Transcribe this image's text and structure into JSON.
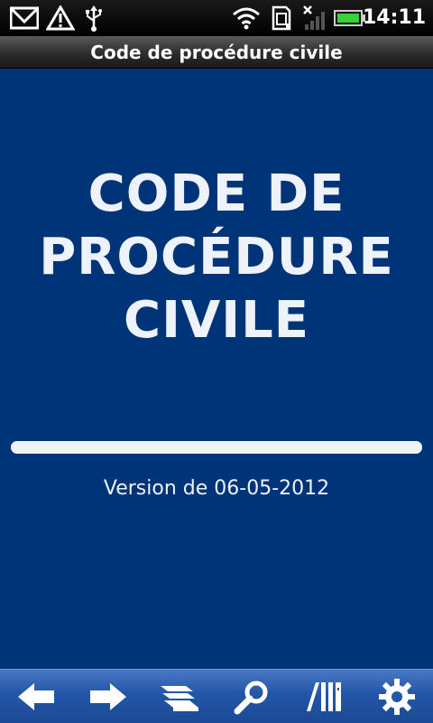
{
  "status_bar": {
    "time": "14:11",
    "icons": [
      "gmail-icon",
      "warning-icon",
      "usb-icon",
      "wifi-icon",
      "sd-card-icon",
      "signal-icon",
      "battery-icon"
    ]
  },
  "app": {
    "title": "Code de procédure civile"
  },
  "main": {
    "title_lines": [
      "CODE DE",
      "PROCÉDURE",
      "CIVILE"
    ],
    "progress": 1.0,
    "version": "Version de 06-05-2012"
  },
  "toolbar": {
    "buttons": [
      "back-arrow-icon",
      "forward-arrow-icon",
      "books-icon",
      "search-icon",
      "library-icon",
      "settings-gear-icon"
    ]
  },
  "colors": {
    "background": "#003478",
    "text": "#eef2fa",
    "toolbar": "#2356a8"
  }
}
